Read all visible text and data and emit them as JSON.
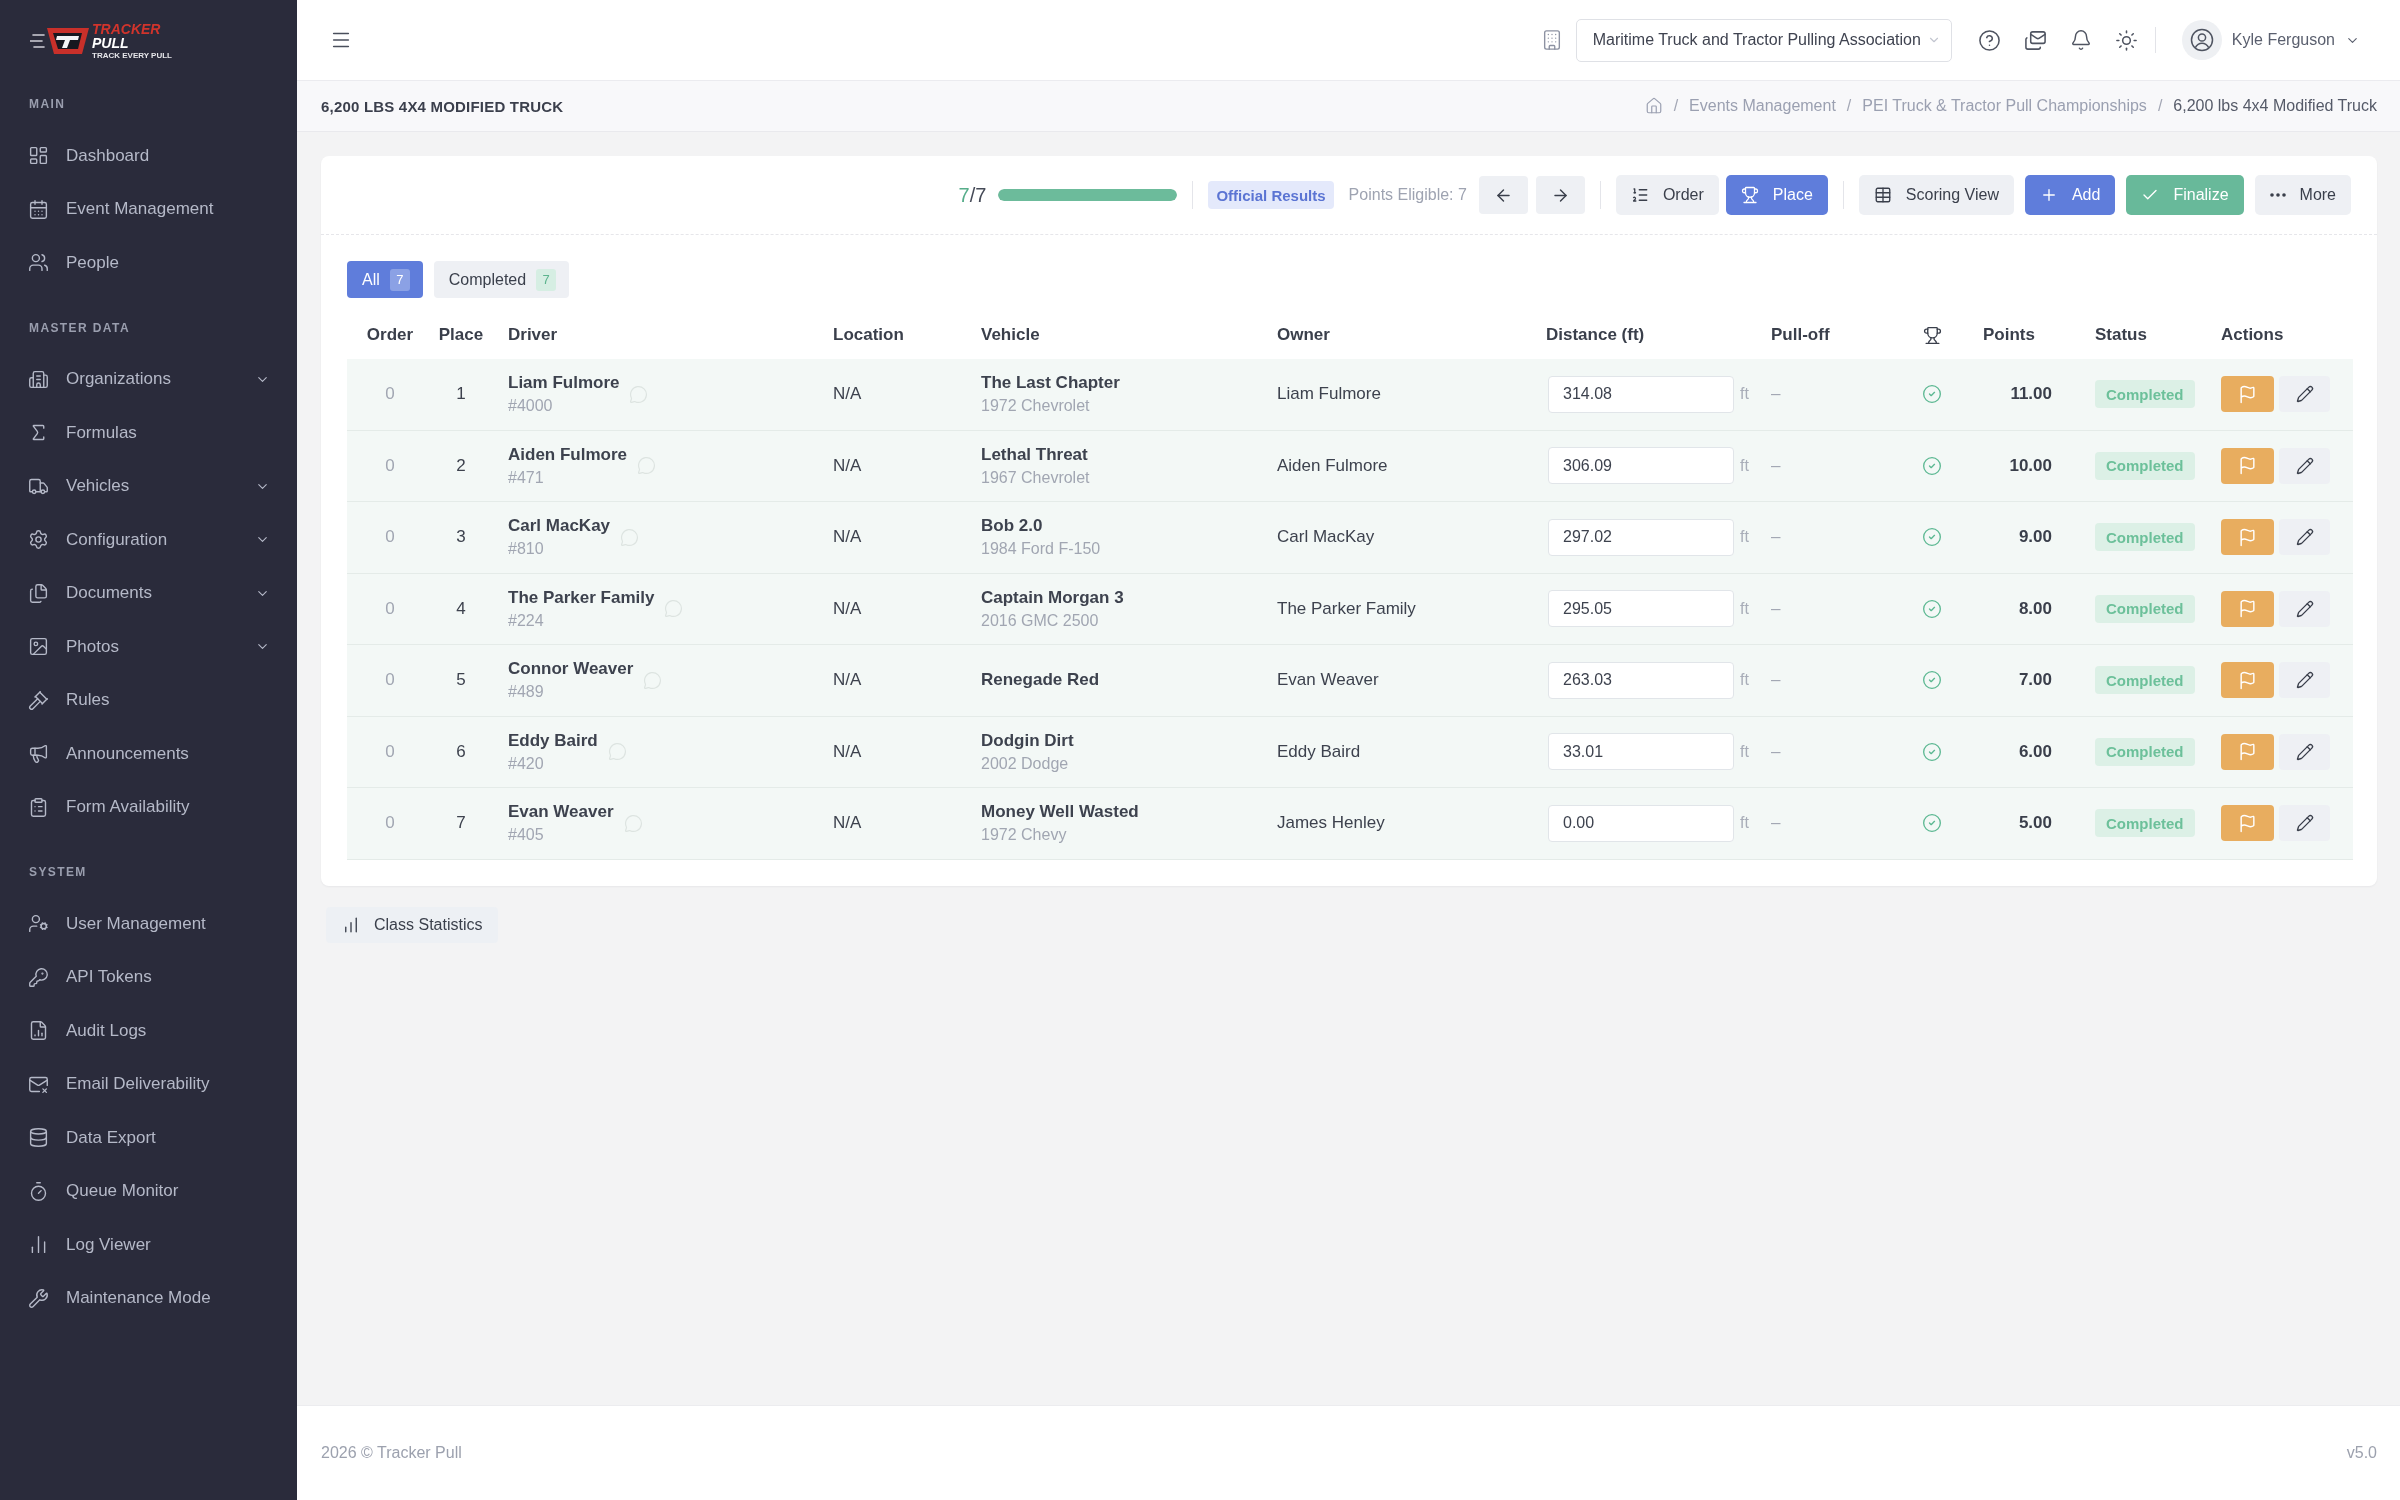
{
  "sidebar": {
    "logo": {
      "top": "TRACKER",
      "bottom": "PULL",
      "tagline": "TRACK EVERY PULL"
    },
    "sections": [
      {
        "title": "MAIN",
        "items": [
          {
            "label": "Dashboard",
            "kind": "link"
          },
          {
            "label": "Event Management",
            "kind": "link"
          },
          {
            "label": "People",
            "kind": "link"
          }
        ]
      },
      {
        "title": "MASTER DATA",
        "items": [
          {
            "label": "Organizations",
            "kind": "group",
            "expanded": false
          },
          {
            "label": "Formulas",
            "kind": "link"
          },
          {
            "label": "Vehicles",
            "kind": "group",
            "expanded": false
          },
          {
            "label": "Configuration",
            "kind": "group",
            "expanded": false
          },
          {
            "label": "Documents",
            "kind": "group",
            "expanded": false
          },
          {
            "label": "Photos",
            "kind": "group",
            "expanded": false
          },
          {
            "label": "Rules",
            "kind": "link"
          },
          {
            "label": "Announcements",
            "kind": "link"
          },
          {
            "label": "Form Availability",
            "kind": "link"
          }
        ]
      },
      {
        "title": "SYSTEM",
        "items": [
          {
            "label": "User Management",
            "kind": "link"
          },
          {
            "label": "API Tokens",
            "kind": "link"
          },
          {
            "label": "Audit Logs",
            "kind": "link"
          },
          {
            "label": "Email Deliverability",
            "kind": "link"
          },
          {
            "label": "Data Export",
            "kind": "link"
          },
          {
            "label": "Queue Monitor",
            "kind": "link"
          },
          {
            "label": "Log Viewer",
            "kind": "link"
          },
          {
            "label": "Maintenance Mode",
            "kind": "link"
          }
        ]
      }
    ]
  },
  "header": {
    "organization": "Maritime Truck and Tractor Pulling Association",
    "user": "Kyle Ferguson"
  },
  "page": {
    "title": "6,200 LBS 4X4 MODIFIED TRUCK",
    "breadcrumbs": [
      {
        "separator": "/",
        "label": "Events Management",
        "current": false
      },
      {
        "separator": "/",
        "label": "PEI Truck & Tractor Pull Championships",
        "current": false
      },
      {
        "separator": "/",
        "label": "6,200 lbs 4x4 Modified Truck",
        "current": true
      }
    ]
  },
  "toolbar": {
    "progress": {
      "done": "7",
      "of_total": "/7",
      "level": 1
    },
    "results_badge": "Official Results",
    "points_eligible": "Points Eligible: 7",
    "view_toggle": [
      {
        "label": "Order",
        "selected": false
      },
      {
        "label": "Place",
        "selected": true
      }
    ],
    "actions": [
      {
        "label": "Scoring View",
        "kind": "secondary"
      },
      {
        "label": "Add",
        "kind": "primary"
      },
      {
        "label": "Finalize",
        "kind": "success"
      },
      {
        "label": "More",
        "kind": "secondary"
      }
    ]
  },
  "filters": [
    {
      "label": "All",
      "count": "7",
      "selected": true
    },
    {
      "label": "Completed",
      "count": "7",
      "selected": false
    }
  ],
  "table": {
    "columns": [
      {
        "kind": "text",
        "label": "Order"
      },
      {
        "kind": "text",
        "label": "Place"
      },
      {
        "kind": "text",
        "label": "Driver"
      },
      {
        "kind": "text",
        "label": "Location"
      },
      {
        "kind": "text",
        "label": "Vehicle"
      },
      {
        "kind": "text",
        "label": "Owner"
      },
      {
        "kind": "text",
        "label": "Distance (ft)"
      },
      {
        "kind": "text",
        "label": "Pull-off"
      },
      {
        "kind": "icon"
      },
      {
        "kind": "text",
        "label": "Points"
      },
      {
        "kind": "text",
        "label": "Status"
      },
      {
        "kind": "text",
        "label": "Actions"
      }
    ],
    "rows": [
      {
        "order": "0",
        "place": "1",
        "driver": "Liam Fulmore",
        "number": "#4000",
        "location": "N/A",
        "vehicle": "The Last Chapter",
        "model": "1972 Chevrolet",
        "owner": "Liam Fulmore",
        "distance": "314.08",
        "unit": "ft",
        "pull_off": "–",
        "eligible": true,
        "points": "11.00",
        "status": "Completed"
      },
      {
        "order": "0",
        "place": "2",
        "driver": "Aiden Fulmore",
        "number": "#471",
        "location": "N/A",
        "vehicle": "Lethal Threat",
        "model": "1967 Chevrolet",
        "owner": "Aiden Fulmore",
        "distance": "306.09",
        "unit": "ft",
        "pull_off": "–",
        "eligible": true,
        "points": "10.00",
        "status": "Completed"
      },
      {
        "order": "0",
        "place": "3",
        "driver": "Carl MacKay",
        "number": "#810",
        "location": "N/A",
        "vehicle": "Bob 2.0",
        "model": "1984 Ford F-150",
        "owner": "Carl MacKay",
        "distance": "297.02",
        "unit": "ft",
        "pull_off": "–",
        "eligible": true,
        "points": "9.00",
        "status": "Completed"
      },
      {
        "order": "0",
        "place": "4",
        "driver": "The Parker Family",
        "number": "#224",
        "location": "N/A",
        "vehicle": "Captain Morgan 3",
        "model": "2016 GMC 2500",
        "owner": "The Parker Family",
        "distance": "295.05",
        "unit": "ft",
        "pull_off": "–",
        "eligible": true,
        "points": "8.00",
        "status": "Completed"
      },
      {
        "order": "0",
        "place": "5",
        "driver": "Connor Weaver",
        "number": "#489",
        "location": "N/A",
        "vehicle": "Renegade Red",
        "owner": "Evan Weaver",
        "distance": "263.03",
        "unit": "ft",
        "pull_off": "–",
        "eligible": true,
        "points": "7.00",
        "status": "Completed"
      },
      {
        "order": "0",
        "place": "6",
        "driver": "Eddy Baird",
        "number": "#420",
        "location": "N/A",
        "vehicle": "Dodgin Dirt",
        "model": "2002 Dodge",
        "owner": "Eddy Baird",
        "distance": "33.01",
        "unit": "ft",
        "pull_off": "–",
        "eligible": true,
        "points": "6.00",
        "status": "Completed"
      },
      {
        "order": "0",
        "place": "7",
        "driver": "Evan Weaver",
        "number": "#405",
        "location": "N/A",
        "vehicle": "Money Well Wasted",
        "model": "1972 Chevy",
        "owner": "James Henley",
        "distance": "0.00",
        "unit": "ft",
        "pull_off": "–",
        "eligible": true,
        "points": "5.00",
        "status": "Completed"
      }
    ]
  },
  "class_statistics": "Class Statistics",
  "footer": {
    "copyright": "2026 © Tracker Pull",
    "version": "v5.0"
  }
}
